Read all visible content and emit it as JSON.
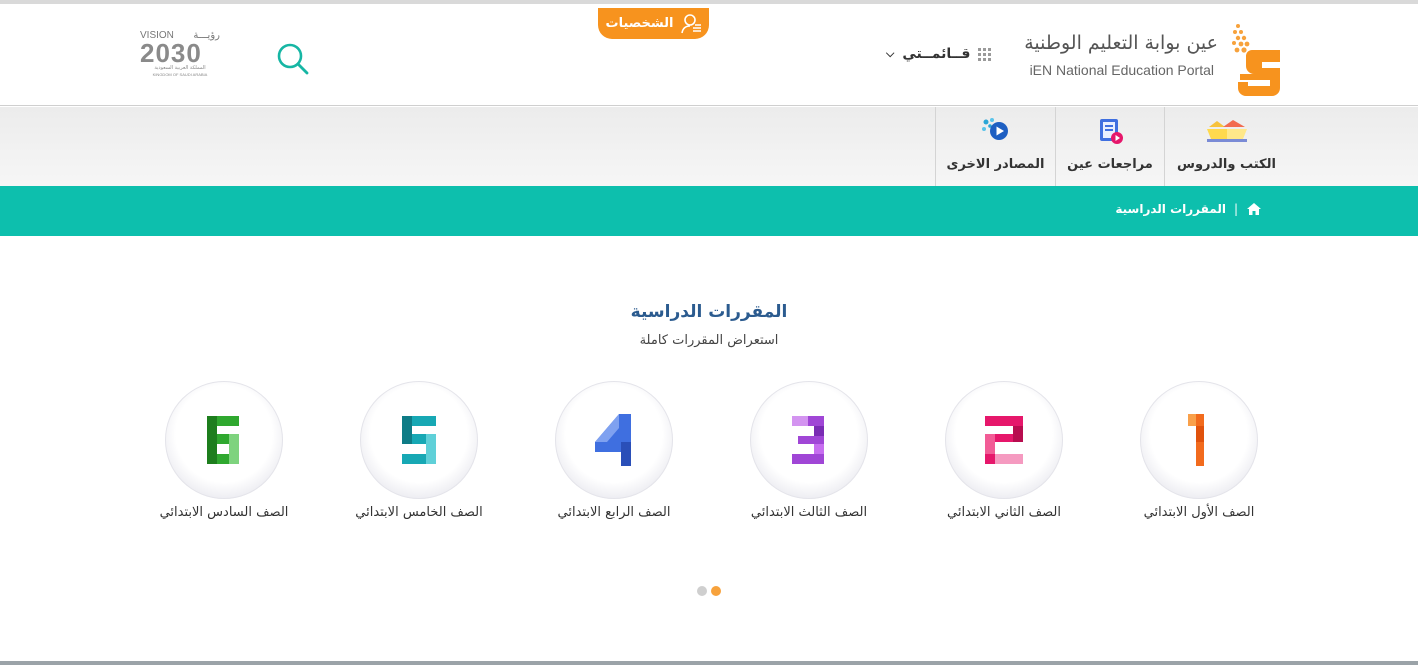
{
  "header": {
    "portal_name_ar": "عين بوابة التعليم الوطنية",
    "portal_name_en": "iEN National Education Portal",
    "menu_label": "قــائمــتي",
    "persons_tab_label": "الشخصيات",
    "vision": {
      "line1_en": "VISION",
      "line1_ar": "رؤيـــة",
      "year": "2030",
      "line3_ar": "المملكة العربية السعودية",
      "line4_en": "KINGDOM OF SAUDI ARABIA"
    }
  },
  "nav": {
    "items": [
      {
        "label": "الكتب والدروس",
        "icon": "open-book-icon"
      },
      {
        "label": "مراجعات عين",
        "icon": "notebook-video-icon"
      },
      {
        "label": "المصادر الاخرى",
        "icon": "play-resources-icon"
      }
    ]
  },
  "breadcrumb": {
    "home_icon": "home-icon",
    "current": "المقررات الدراسية"
  },
  "main": {
    "title": "المقررات الدراسية",
    "subtitle": "استعراض المقررات كاملة",
    "grades": [
      {
        "number": "1",
        "label": "الصف الأول الابتدائي",
        "color": "#f26b1d"
      },
      {
        "number": "2",
        "label": "الصف الثاني الابتدائي",
        "color": "#e6176b"
      },
      {
        "number": "3",
        "label": "الصف الثالث الابتدائي",
        "color": "#a046d6"
      },
      {
        "number": "4",
        "label": "الصف الرابع الابتدائي",
        "color": "#3f6fe0"
      },
      {
        "number": "5",
        "label": "الصف الخامس الابتدائي",
        "color": "#17a8b4"
      },
      {
        "number": "6",
        "label": "الصف السادس الابتدائي",
        "color": "#2fa82f"
      }
    ]
  },
  "carousel": {
    "pages": 2,
    "active_page": 2
  },
  "colors": {
    "accent": "#0dbfad",
    "orange": "#f7931e",
    "title_blue": "#2b5b8f"
  }
}
